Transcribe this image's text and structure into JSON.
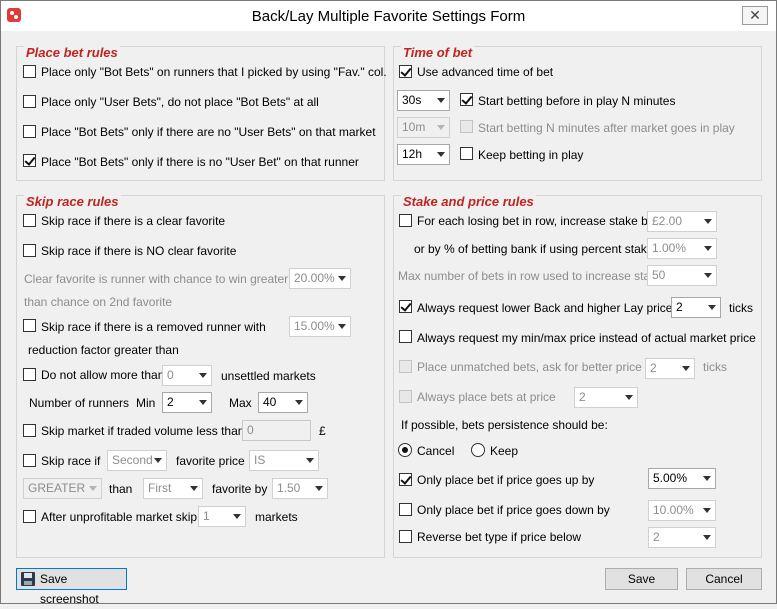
{
  "window": {
    "title": "Back/Lay Multiple Favorite Settings Form",
    "close_glyph": "✕"
  },
  "place_bet": {
    "title": "Place bet rules",
    "opt1": "Place only \"Bot Bets\" on runners that I picked by using \"Fav.\" col.",
    "opt2": "Place only \"User Bets\", do not place \"Bot Bets\" at all",
    "opt3": "Place \"Bot Bets\" only if there are no \"User Bets\" on that market",
    "opt4": "Place \"Bot Bets\" only if there is no \"User Bet\" on that runner"
  },
  "time_of_bet": {
    "title": "Time of bet",
    "advanced": "Use advanced time of bet",
    "combo1": "30s",
    "start_before": "Start betting before in play N minutes",
    "combo2": "10m",
    "start_after": "Start betting N minutes after market goes in play",
    "combo3": "12h",
    "keep_betting": "Keep betting in play"
  },
  "skip_race": {
    "title": "Skip race rules",
    "clear_fav": "Skip race if there is a clear favorite",
    "no_clear_fav": "Skip race if there is NO clear favorite",
    "clear_fav_desc1": "Clear favorite is runner with chance to win greater by",
    "clear_fav_desc2": "than chance on 2nd favorite",
    "clear_fav_pct": "20.00%",
    "removed_runner1": "Skip race if there is a removed runner with",
    "removed_runner2": "reduction factor greater than",
    "removed_pct": "15.00%",
    "not_allow_more": "Do not allow more than",
    "unsettled_value": "0",
    "unsettled_markets": "unsettled markets",
    "num_runners": "Number of runners",
    "min_label": "Min",
    "min_value": "2",
    "max_label": "Max",
    "max_value": "40",
    "traded_volume": "Skip market if traded volume less than",
    "traded_value": "0",
    "currency": "£",
    "skip_race_if": "Skip race if",
    "second_value": "Second",
    "favorite_price": "favorite price",
    "is_value": "IS",
    "greater_value": "GREATER",
    "than": "than",
    "first_value": "First",
    "favorite_by": "favorite by",
    "by_value": "1.50",
    "after_unprofitable": "After unprofitable market skip",
    "skip_count": "1",
    "markets": "markets"
  },
  "stake": {
    "title": "Stake and price rules",
    "losing_bet": "For each losing bet in row, increase stake by",
    "stake_amount": "£2.00",
    "or_percent": "or by % of betting bank if using percent staking",
    "percent_value": "1.00%",
    "max_bets": "Max number of bets in row used to increase stake",
    "max_bets_value": "50",
    "lower_back": "Always request lower Back and higher Lay price by",
    "ticks_value": "2",
    "ticks": "ticks",
    "min_max_price": "Always request my min/max price instead of actual market price",
    "unmatched": "Place unmatched bets, ask for better price by",
    "unmatched_value": "2",
    "unmatched_ticks": "ticks",
    "always_place": "Always place bets at price",
    "always_place_value": "2",
    "persistence": "If possible, bets persistence should be:",
    "cancel": "Cancel",
    "keep": "Keep",
    "price_up": "Only place bet if price goes up by",
    "price_up_value": "5.00%",
    "price_down": "Only place bet if price goes down by",
    "price_down_value": "10.00%",
    "reverse": "Reverse bet type if price below",
    "reverse_value": "2"
  },
  "footer": {
    "screenshot": "Save screenshot",
    "save": "Save",
    "cancel": "Cancel"
  }
}
